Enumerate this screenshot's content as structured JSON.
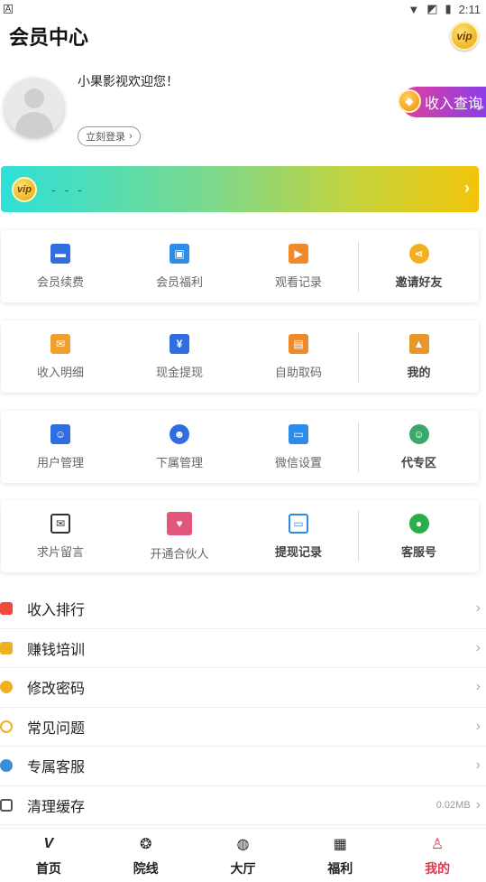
{
  "status": {
    "time": "2:11",
    "left_icon": "A"
  },
  "header": {
    "title": "会员中心",
    "vip_badge": "vip"
  },
  "profile": {
    "welcome": "小果影视欢迎您！",
    "login_label": "立刻登录",
    "income_query_label": "收入查询",
    "income_query_mask": "***"
  },
  "vip_bar": {
    "badge": "vip",
    "status_text": "- - -"
  },
  "cards": [
    {
      "items": [
        {
          "label": "会员续费",
          "icon": "wallet-icon",
          "color": "#2f6de1"
        },
        {
          "label": "会员福利",
          "icon": "gift-icon",
          "color": "#2f8be8"
        },
        {
          "label": "观看记录",
          "icon": "tv-icon",
          "color": "#f0892a"
        }
      ],
      "feature": {
        "label": "邀请好友",
        "icon": "share-icon",
        "color": "#f2b021"
      }
    },
    {
      "items": [
        {
          "label": "收入明细",
          "icon": "envelope-icon",
          "color": "#f0a030"
        },
        {
          "label": "现金提现",
          "icon": "cash-icon",
          "color": "#2f6de1"
        },
        {
          "label": "自助取码",
          "icon": "code-icon",
          "color": "#f0892a"
        }
      ],
      "feature": {
        "label": "我的",
        "icon": "image-icon",
        "color": "#e8962a"
      }
    },
    {
      "items": [
        {
          "label": "用户管理",
          "icon": "contacts-icon",
          "color": "#2f6de1"
        },
        {
          "label": "下属管理",
          "icon": "group-icon",
          "color": "#2f6de1"
        },
        {
          "label": "微信设置",
          "icon": "monitor-icon",
          "color": "#2f8be8"
        }
      ],
      "feature": {
        "label": "代专区",
        "icon": "agent-icon",
        "color": "#3aa86b"
      }
    },
    {
      "items": [
        {
          "label": "求片留言",
          "icon": "mail-icon",
          "color": "#333333"
        },
        {
          "label": "开通合伙人",
          "icon": "partner-icon",
          "color": "#e0577a"
        },
        {
          "label": "提现记录",
          "icon": "laptop-icon",
          "color": "#2f8be8"
        }
      ],
      "feature": {
        "label": "客服号",
        "icon": "wechat-icon",
        "color": "#2aae4a"
      }
    }
  ],
  "list": [
    {
      "label": "收入排行",
      "icon": "ranking-icon",
      "color": "#f04a3a",
      "extra": ""
    },
    {
      "label": "赚钱培训",
      "icon": "book-icon",
      "color": "#f0b020",
      "extra": ""
    },
    {
      "label": "修改密码",
      "icon": "key-icon",
      "color": "#f0b020",
      "extra": ""
    },
    {
      "label": "常见问题",
      "icon": "question-icon",
      "color": "#f0b020",
      "extra": ""
    },
    {
      "label": "专属客服",
      "icon": "service-icon",
      "color": "#3a8ed8",
      "extra": ""
    },
    {
      "label": "清理缓存",
      "icon": "trash-icon",
      "color": "#555555",
      "extra": "0.02MB"
    }
  ],
  "tabbar": [
    {
      "label": "首页",
      "icon": "vip-home-icon",
      "active": false
    },
    {
      "label": "院线",
      "icon": "film-reel-icon",
      "active": false
    },
    {
      "label": "大厅",
      "icon": "planet-icon",
      "active": false
    },
    {
      "label": "福利",
      "icon": "gift-box-icon",
      "active": false
    },
    {
      "label": "我的",
      "icon": "person-icon",
      "active": true
    }
  ],
  "colors": {
    "accent": "#e6354a",
    "income_gradient_start": "#e2409a",
    "income_gradient_end": "#8a3ee8"
  }
}
